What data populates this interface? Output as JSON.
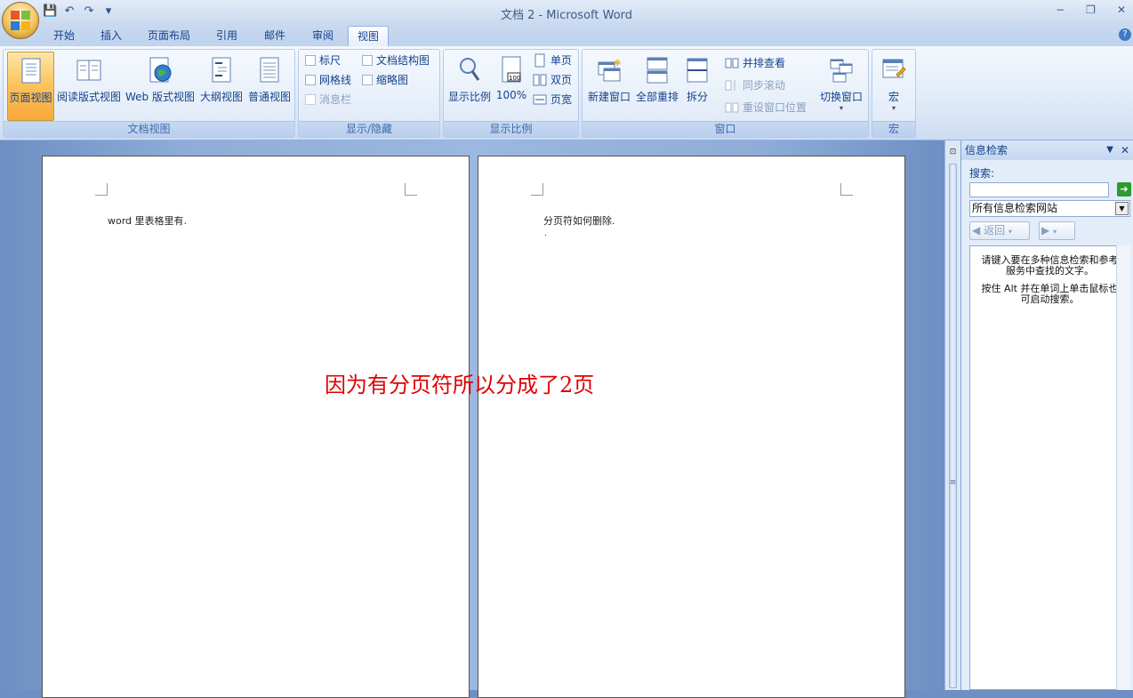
{
  "window": {
    "title": "文档 2 - Microsoft Word",
    "minimize": "−",
    "restore": "❐",
    "close": "✕"
  },
  "qat": {
    "save": "💾",
    "undo": "↶",
    "redo": "↷",
    "customize": "▾"
  },
  "tabs": [
    {
      "label": "开始"
    },
    {
      "label": "插入"
    },
    {
      "label": "页面布局"
    },
    {
      "label": "引用"
    },
    {
      "label": "邮件"
    },
    {
      "label": "审阅"
    },
    {
      "label": "视图",
      "active": true
    }
  ],
  "help": "?",
  "ribbon": {
    "views": {
      "label": "文档视图",
      "items": [
        "页面视图",
        "阅读版式视图",
        "Web 版式视图",
        "大纲视图",
        "普通视图"
      ]
    },
    "show_hide": {
      "label": "显示/隐藏",
      "ruler": "标尺",
      "gridlines": "网格线",
      "message_bar": "消息栏",
      "doc_map": "文档结构图",
      "thumbnails": "缩略图"
    },
    "zoom": {
      "label": "显示比例",
      "zoom": "显示比例",
      "hundred": "100%",
      "one_page": "单页",
      "two_pages": "双页",
      "page_width": "页宽"
    },
    "window": {
      "label": "窗口",
      "new_window": "新建窗口",
      "arrange_all": "全部重排",
      "split": "拆分",
      "side_by_side": "并排查看",
      "sync_scroll": "同步滚动",
      "reset_position": "重设窗口位置",
      "switch_windows": "切换窗口"
    },
    "macros": {
      "label": "宏",
      "macros": "宏"
    }
  },
  "document": {
    "page1_text": "word 里表格里有.",
    "page2_text": "分页符如何删除.",
    "page2_para_mark": ".",
    "annotation": "因为有分页符所以分成了2页"
  },
  "research_pane": {
    "title": "信息检索",
    "search_label": "搜索:",
    "search_value": "",
    "source": "所有信息检索网站",
    "back": "返回",
    "forward": "",
    "hint1": "请键入要在多种信息检索和参考服务中查找的文字。",
    "hint2": "按住 Alt 并在单词上单击鼠标也可启动搜索。"
  },
  "colors": {
    "annotation": "#e00000",
    "accent": "#15428b",
    "selected": "#fbc25a"
  }
}
